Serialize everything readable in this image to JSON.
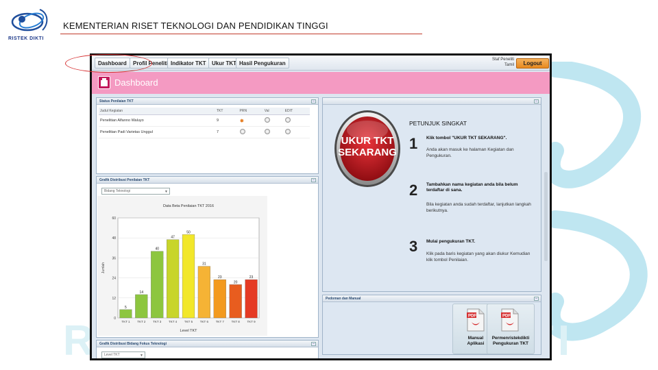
{
  "header": {
    "logo_text": "RISTEK DIKTI",
    "title": "KEMENTERIAN RISET TEKNOLOGI DAN PENDIDIKAN TINGGI"
  },
  "background": {
    "watermark_left": "R",
    "watermark_right": "TI"
  },
  "nav": {
    "tabs": [
      "Dashboard",
      "Profil Peneliti",
      "Indikator TKT",
      "Ukur TKT",
      "Hasil Pengukuran"
    ],
    "user_line1": "Staf Peneliti",
    "user_line2": "Tamil",
    "logout": "Logout"
  },
  "page_title": "Dashboard",
  "status_panel": {
    "title": "Status Penilaian TKT",
    "columns": [
      "Judul Kegiatan",
      "TKT",
      "PRN",
      "Val",
      "EDIT"
    ],
    "rows": [
      {
        "judul": "Penelitian Alfanno Waluyo",
        "tkt": "9"
      },
      {
        "judul": "Penelitian Padi Varietas Unggul",
        "tkt": "7"
      }
    ]
  },
  "grafik_panel": {
    "title": "Grafik Distribusi Penilaian TKT",
    "select_value": "Bidang Teknologi"
  },
  "grafik2_panel": {
    "title": "Grafik Distribusi Bidang Fokus Teknologi",
    "select_value": "Level TKT"
  },
  "chart_data": {
    "type": "bar",
    "title": "Data Beta Penilaian TKT 2016",
    "xlabel": "Level TKT",
    "ylabel": "Jumlah",
    "categories": [
      "TKT 1",
      "TKT 2",
      "TKT 3",
      "TKT 4",
      "TKT 5",
      "TKT 6",
      "TKT 7",
      "TKT 8",
      "TKT 9"
    ],
    "values": [
      5,
      14,
      40,
      47,
      50,
      31,
      23,
      20,
      23
    ],
    "data_labels": [
      "5",
      "14",
      "40",
      "47",
      "50",
      "31",
      "23",
      "20",
      "23"
    ],
    "colors": [
      "#8dc63f",
      "#8dc63f",
      "#8dc63f",
      "#c8d52a",
      "#f2e72a",
      "#f5b335",
      "#f39a1e",
      "#e85d1f",
      "#e53a24"
    ],
    "ylim": [
      0,
      60
    ],
    "yticks": [
      "0",
      "12",
      "24",
      "36",
      "48",
      "60"
    ],
    "grid": true
  },
  "right_panel": {
    "button_line1": "UKUR TKT",
    "button_line2": "SEKARANG",
    "petunjuk_title": "PETUNJUK SINGKAT",
    "steps": [
      {
        "num": "1",
        "head": "Klik tombol \"UKUR TKT SEKARANG\".",
        "desc": "Anda akan masuk ke halaman Kegiatan dan Pengukuran."
      },
      {
        "num": "2",
        "head": "Tambahkan nama kegiatan anda bila belum terdaftar di sana.",
        "desc": "Bila kegiatan anda sudah terdaftar, lanjutkan langkah berikutnya."
      },
      {
        "num": "3",
        "head": "Mulai pengukuran TKT.",
        "desc": "Klik pada baris kegiatan yang akan diukur Kemudian klik tombol Penilaian."
      }
    ]
  },
  "pedoman_panel": {
    "title": "Pedoman dan Manual",
    "docs": [
      {
        "badge": "PDF",
        "line1": "Manual",
        "line2": "Aplikasi"
      },
      {
        "badge": "PDF",
        "line1": "Permenristekdikti",
        "line2": "Pengukuran TKT"
      }
    ]
  },
  "colors": {
    "title_bar": "#f49ac2",
    "logout": "#e8891f",
    "annotation": "#d63031",
    "big_button": "#c0171d"
  }
}
